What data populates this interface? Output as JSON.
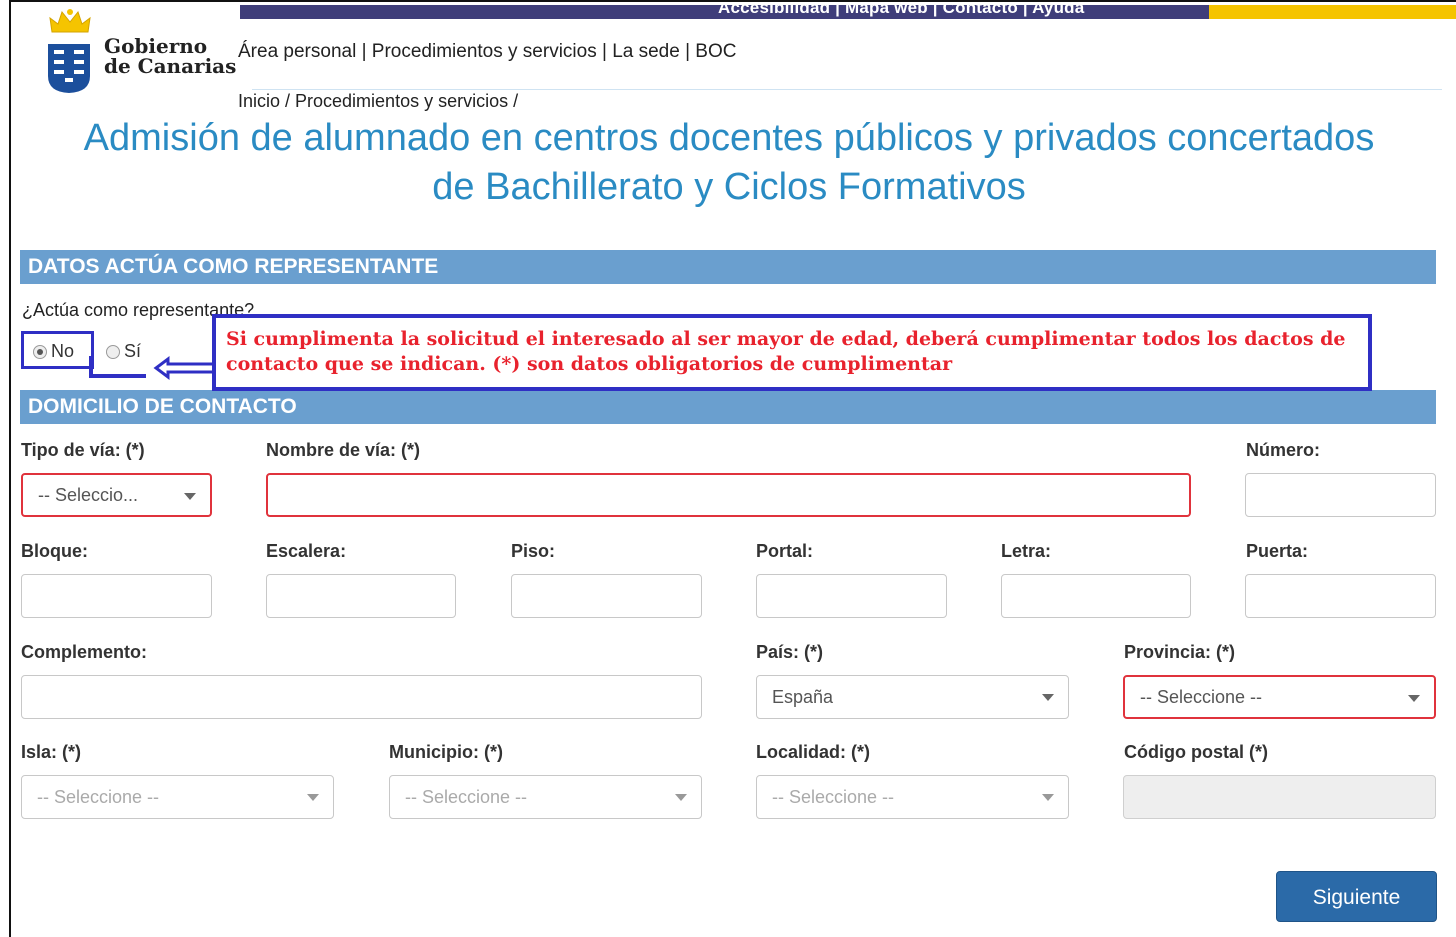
{
  "header": {
    "top_links": "Accesibilidad  |  Mapa web  |  Contacto  |  Ayuda",
    "logo_line1": "Gobierno",
    "logo_line2": "de Canarias",
    "nav": "Área personal | Procedimientos y servicios | La sede | BOC",
    "breadcrumb": "Inicio / Procedimientos y servicios /"
  },
  "page": {
    "title_line1": "Admisión de alumnado en centros docentes públicos y privados concertados",
    "title_line2": "de Bachillerato y Ciclos Formativos"
  },
  "representante": {
    "section_title": "DATOS ACTÚA COMO REPRESENTANTE",
    "question": "¿Actúa como representante?",
    "option_no": "No",
    "option_si": "Sí",
    "selected": "No",
    "note": "Si cumplimenta la solicitud el interesado al ser mayor de edad, deberá cumplimentar todos los dactos de contacto que se indican. (*) son datos obligatorios de cumplimentar"
  },
  "domicilio": {
    "section_title": "DOMICILIO DE CONTACTO",
    "tipo_via_label": "Tipo de vía: (*)",
    "tipo_via_value": "-- Seleccio...",
    "nombre_via_label": "Nombre de vía: (*)",
    "nombre_via_value": "",
    "numero_label": "Número:",
    "bloque_label": "Bloque:",
    "escalera_label": "Escalera:",
    "piso_label": "Piso:",
    "portal_label": "Portal:",
    "letra_label": "Letra:",
    "puerta_label": "Puerta:",
    "complemento_label": "Complemento:",
    "pais_label": "País: (*)",
    "pais_value": "España",
    "provincia_label": "Provincia: (*)",
    "provincia_value": "-- Seleccione --",
    "isla_label": "Isla: (*)",
    "isla_value": "-- Seleccione --",
    "municipio_label": "Municipio: (*)",
    "municipio_value": "-- Seleccione --",
    "localidad_label": "Localidad: (*)",
    "localidad_value": "-- Seleccione --",
    "cp_label": "Código postal (*)",
    "cp_value": ""
  },
  "actions": {
    "next_label": "Siguiente"
  },
  "colors": {
    "accent": "#2a8bc3",
    "section_bar": "#6a9fcf",
    "required": "#e0333c",
    "annotation": "#2f2fc4",
    "button": "#2b6aa8"
  }
}
